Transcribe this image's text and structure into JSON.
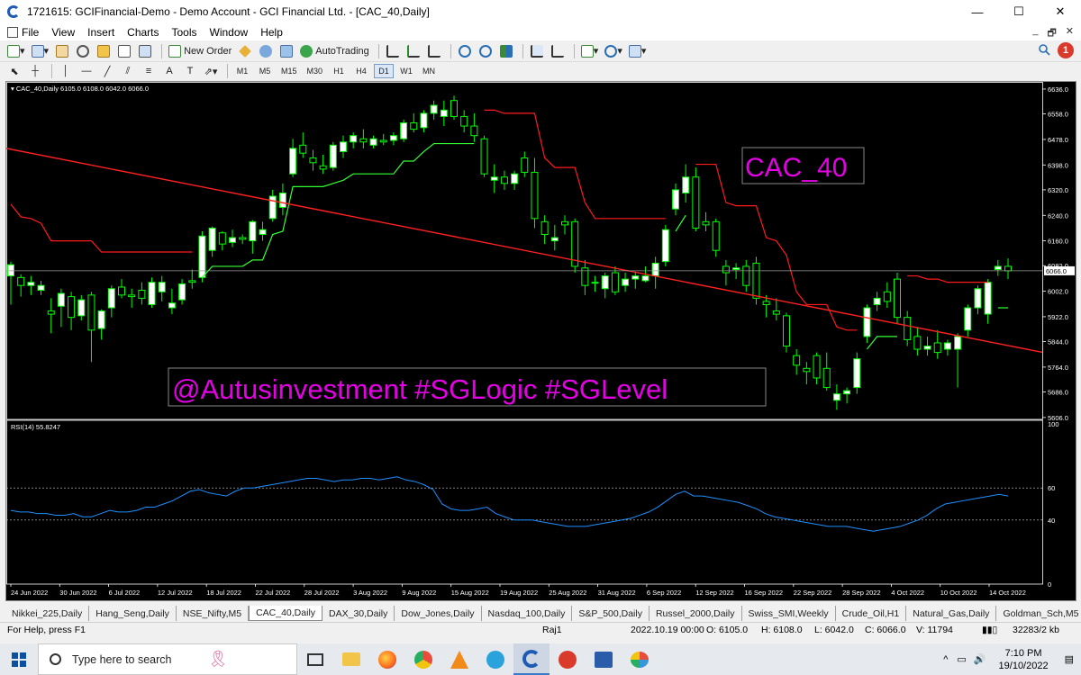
{
  "window": {
    "title": "1721615: GCIFinancial-Demo - Demo Account - GCI Financial Ltd. - [CAC_40,Daily]",
    "minimize": "—",
    "maximize": "☐",
    "close": "✕"
  },
  "menu": {
    "items": [
      "File",
      "View",
      "Insert",
      "Charts",
      "Tools",
      "Window",
      "Help"
    ],
    "mdi": [
      "_",
      "🗗",
      "✕"
    ]
  },
  "toolbar": {
    "new_order": "New Order",
    "auto_trading": "AutoTrading",
    "notification_count": "1",
    "timeframes": [
      "M1",
      "M5",
      "M15",
      "M30",
      "H1",
      "H4",
      "D1",
      "W1",
      "MN"
    ],
    "active_timeframe": "D1",
    "text_tool": "A",
    "text_label_tool": "T"
  },
  "chart": {
    "info": "CAC_40,Daily  6105.0 6108.0 6042.0 6066.0",
    "symbol_label": "CAC_40",
    "watermark": "@Autusinvestment  #SGLogic  #SGLevel",
    "current_price_label": "6066.0",
    "rsi_label": "RSI(14) 55.8247",
    "colors": {
      "background": "#000000",
      "bull_fill": "#ffffff",
      "bear_fill": "#000000",
      "candle_outline": "#00ff00",
      "trailing_stop_up": "#33ff33",
      "trailing_stop_down": "#ff1a1a",
      "trendline": "#ff2020",
      "rsi_line": "#1e90ff",
      "annotation_text": "#e600e6"
    }
  },
  "chart_data": {
    "type": "candlestick",
    "title": "CAC_40,Daily",
    "price_ticks": [
      "6636.0",
      "6558.0",
      "6478.0",
      "6398.0",
      "6320.0",
      "6240.0",
      "6160.0",
      "6082.0",
      "6002.0",
      "5922.0",
      "5844.0",
      "5764.0",
      "5686.0",
      "5606.0"
    ],
    "ylim": [
      5600,
      6650
    ],
    "x_ticks": [
      "24 Jun 2022",
      "30 Jun 2022",
      "6 Jul 2022",
      "12 Jul 2022",
      "18 Jul 2022",
      "22 Jul 2022",
      "28 Jul 2022",
      "3 Aug 2022",
      "9 Aug 2022",
      "15 Aug 2022",
      "19 Aug 2022",
      "25 Aug 2022",
      "31 Aug 2022",
      "6 Sep 2022",
      "12 Sep 2022",
      "16 Sep 2022",
      "22 Sep 2022",
      "28 Sep 2022",
      "4 Oct 2022",
      "10 Oct 2022",
      "14 Oct 2022"
    ],
    "candles": [
      [
        6050,
        6095,
        5960,
        6085
      ],
      [
        6045,
        6055,
        5985,
        6020
      ],
      [
        6020,
        6050,
        5990,
        6030
      ],
      [
        6005,
        6035,
        5990,
        6020
      ],
      [
        5940,
        5980,
        5870,
        5930
      ],
      [
        5955,
        6010,
        5890,
        5995
      ],
      [
        5985,
        6000,
        5880,
        5920
      ],
      [
        5925,
        5990,
        5910,
        5975
      ],
      [
        5990,
        6000,
        5780,
        5880
      ],
      [
        5885,
        5945,
        5850,
        5940
      ],
      [
        5950,
        6020,
        5920,
        6010
      ],
      [
        6015,
        6040,
        5980,
        5990
      ],
      [
        5990,
        6010,
        5950,
        5985
      ],
      [
        6005,
        6030,
        5960,
        5980
      ],
      [
        5960,
        6045,
        5950,
        6030
      ],
      [
        6000,
        6050,
        5970,
        6030
      ],
      [
        5950,
        6010,
        5930,
        5965
      ],
      [
        5975,
        6040,
        5960,
        6025
      ],
      [
        6035,
        6070,
        6010,
        6030
      ],
      [
        6045,
        6190,
        6030,
        6175
      ],
      [
        6130,
        6205,
        6110,
        6200
      ],
      [
        6185,
        6190,
        6130,
        6150
      ],
      [
        6155,
        6195,
        6140,
        6170
      ],
      [
        6170,
        6180,
        6150,
        6165
      ],
      [
        6160,
        6225,
        6120,
        6220
      ],
      [
        6180,
        6220,
        6160,
        6195
      ],
      [
        6230,
        6320,
        6220,
        6300
      ],
      [
        6265,
        6340,
        6240,
        6310
      ],
      [
        6370,
        6480,
        6360,
        6450
      ],
      [
        6460,
        6500,
        6420,
        6435
      ],
      [
        6420,
        6445,
        6380,
        6405
      ],
      [
        6395,
        6430,
        6370,
        6385
      ],
      [
        6390,
        6470,
        6380,
        6460
      ],
      [
        6440,
        6490,
        6420,
        6470
      ],
      [
        6470,
        6500,
        6450,
        6490
      ],
      [
        6480,
        6510,
        6450,
        6470
      ],
      [
        6460,
        6490,
        6450,
        6480
      ],
      [
        6475,
        6495,
        6460,
        6470
      ],
      [
        6475,
        6500,
        6460,
        6490
      ],
      [
        6480,
        6540,
        6470,
        6530
      ],
      [
        6530,
        6560,
        6500,
        6510
      ],
      [
        6515,
        6570,
        6500,
        6560
      ],
      [
        6560,
        6600,
        6540,
        6585
      ],
      [
        6550,
        6600,
        6520,
        6570
      ],
      [
        6600,
        6615,
        6540,
        6550
      ],
      [
        6550,
        6570,
        6500,
        6520
      ],
      [
        6520,
        6560,
        6470,
        6490
      ],
      [
        6480,
        6490,
        6360,
        6370
      ],
      [
        6350,
        6400,
        6310,
        6360
      ],
      [
        6360,
        6380,
        6320,
        6340
      ],
      [
        6340,
        6380,
        6320,
        6370
      ],
      [
        6420,
        6440,
        6360,
        6375
      ],
      [
        6375,
        6420,
        6200,
        6230
      ],
      [
        6220,
        6240,
        6150,
        6180
      ],
      [
        6160,
        6210,
        6130,
        6170
      ],
      [
        6220,
        6240,
        6180,
        6210
      ],
      [
        6220,
        6230,
        6060,
        6080
      ],
      [
        6075,
        6100,
        5990,
        6020
      ],
      [
        6030,
        6050,
        6000,
        6030
      ],
      [
        6010,
        6060,
        5980,
        6050
      ],
      [
        6060,
        6080,
        5990,
        6000
      ],
      [
        6020,
        6060,
        6000,
        6040
      ],
      [
        6040,
        6060,
        6010,
        6050
      ],
      [
        6035,
        6080,
        6030,
        6050
      ],
      [
        6050,
        6110,
        6010,
        6090
      ],
      [
        6095,
        6210,
        6080,
        6195
      ],
      [
        6260,
        6340,
        6240,
        6320
      ],
      [
        6310,
        6400,
        6280,
        6360
      ],
      [
        6360,
        6390,
        6190,
        6200
      ],
      [
        6220,
        6250,
        6190,
        6210
      ],
      [
        6220,
        6230,
        6110,
        6130
      ],
      [
        6080,
        6100,
        6020,
        6060
      ],
      [
        6070,
        6090,
        6040,
        6075
      ],
      [
        6080,
        6100,
        6000,
        6020
      ],
      [
        6090,
        6110,
        5960,
        5980
      ],
      [
        5970,
        5990,
        5920,
        5960
      ],
      [
        5940,
        5980,
        5910,
        5930
      ],
      [
        5925,
        5935,
        5810,
        5830
      ],
      [
        5800,
        5820,
        5740,
        5770
      ],
      [
        5760,
        5780,
        5710,
        5750
      ],
      [
        5800,
        5810,
        5710,
        5730
      ],
      [
        5760,
        5810,
        5690,
        5700
      ],
      [
        5660,
        5710,
        5630,
        5680
      ],
      [
        5680,
        5700,
        5650,
        5690
      ],
      [
        5700,
        5810,
        5680,
        5790
      ],
      [
        5860,
        5960,
        5840,
        5950
      ],
      [
        5960,
        6000,
        5940,
        5980
      ],
      [
        6000,
        6030,
        5950,
        5970
      ],
      [
        6040,
        6060,
        5900,
        5920
      ],
      [
        5920,
        5940,
        5830,
        5850
      ],
      [
        5860,
        5890,
        5800,
        5820
      ],
      [
        5820,
        5860,
        5800,
        5830
      ],
      [
        5840,
        5880,
        5790,
        5810
      ],
      [
        5820,
        5850,
        5800,
        5840
      ],
      [
        5820,
        5870,
        5700,
        5860
      ],
      [
        5880,
        5960,
        5860,
        5950
      ],
      [
        5950,
        6020,
        5930,
        6010
      ],
      [
        5930,
        6040,
        5900,
        6030
      ],
      [
        6070,
        6100,
        6050,
        6080
      ],
      [
        6080,
        6105,
        6040,
        6066
      ]
    ],
    "rsi": {
      "name": "RSI(14)",
      "last": 55.8247,
      "ylim": [
        0,
        100
      ],
      "levels": [
        40,
        60
      ],
      "tick_labels": [
        "100",
        "60",
        "40",
        "0"
      ],
      "values": [
        46,
        45,
        45,
        44,
        44,
        43,
        43,
        44,
        42,
        42,
        44,
        46,
        45,
        45,
        46,
        48,
        48,
        50,
        52,
        55,
        58,
        59,
        57,
        56,
        55,
        58,
        60,
        60,
        61,
        62,
        63,
        64,
        65,
        66,
        66,
        65,
        64,
        65,
        65,
        66,
        66,
        65,
        66,
        67,
        65,
        64,
        62,
        59,
        50,
        47,
        46,
        46,
        47,
        48,
        44,
        42,
        40,
        40,
        40,
        39,
        38,
        37,
        36,
        36,
        36,
        37,
        38,
        39,
        40,
        41,
        43,
        45,
        48,
        52,
        56,
        58,
        55,
        55,
        54,
        53,
        52,
        51,
        49,
        47,
        44,
        42,
        41,
        40,
        39,
        38,
        37,
        36,
        36,
        36,
        35,
        34,
        33,
        34,
        35,
        36,
        38,
        40,
        43,
        47,
        50,
        51,
        52,
        53,
        54,
        55,
        56,
        55
      ]
    },
    "trendline": {
      "from": [
        "24 Jun 2022",
        6450
      ],
      "to": [
        "18 Oct 2022",
        5850
      ]
    }
  },
  "tabs": {
    "items": [
      "Nikkei_225,Daily",
      "Hang_Seng,Daily",
      "NSE_Nifty,M5",
      "CAC_40,Daily",
      "DAX_30,Daily",
      "Dow_Jones,Daily",
      "Nasdaq_100,Daily",
      "S&P_500,Daily",
      "Russel_2000,Daily",
      "Swiss_SMI,Weekly",
      "Crude_Oil,H1",
      "Natural_Gas,Daily",
      "Goldman_Sch,M5"
    ],
    "active": "CAC_40,Daily"
  },
  "status": {
    "help": "For Help, press F1",
    "profile": "Raj1",
    "datetime": "2022.10.19 00:00",
    "open": "O: 6105.0",
    "high": "H: 6108.0",
    "low": "L: 6042.0",
    "close": "C: 6066.0",
    "volume": "V: 11794",
    "traffic": "32283/2 kb"
  },
  "taskbar": {
    "search_placeholder": "Type here to search",
    "time": "7:10 PM",
    "date": "19/10/2022",
    "tray_chevron": "^"
  }
}
